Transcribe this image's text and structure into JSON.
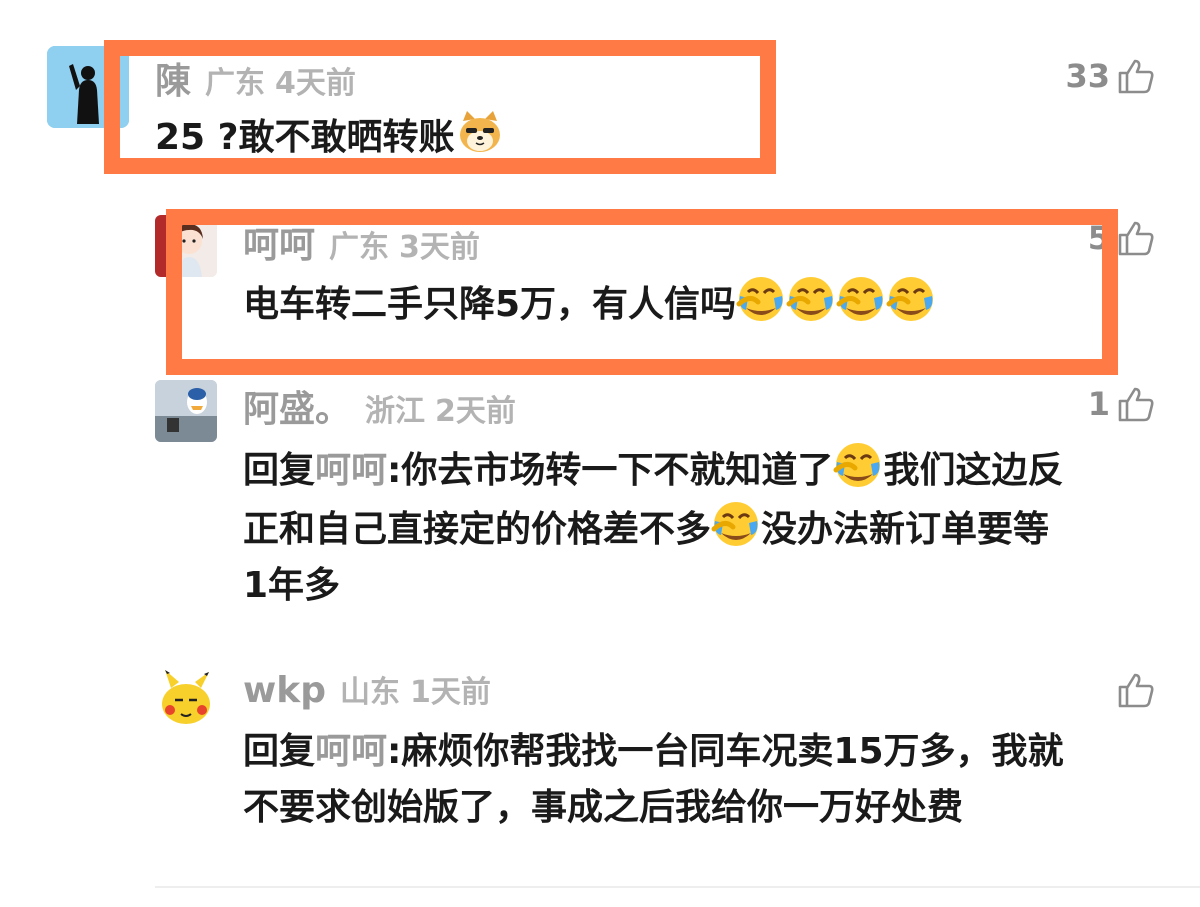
{
  "comments": [
    {
      "name": "陳",
      "location": "广东",
      "time": "4天前",
      "likes": "33",
      "lines": [
        "25 ?敢不敢晒转账"
      ]
    },
    {
      "name": "呵呵",
      "location": "广东",
      "time": "3天前",
      "likes": "5",
      "lines": [
        "电车转二手只降5万，有人信吗"
      ]
    },
    {
      "name": "阿盛。",
      "location": "浙江",
      "time": "2天前",
      "likes": "1",
      "reply_prefix": "回复",
      "reply_to": "呵呵",
      "lines": [
        ":你去市场转一下不就知道了",
        "我们这边反",
        "正和自己直接定的价格差不多",
        "没办法新订单要等",
        "1年多"
      ]
    },
    {
      "name": "wkp",
      "location": "山东",
      "time": "1天前",
      "likes": "",
      "reply_prefix": "回复",
      "reply_to": "呵呵",
      "lines": [
        ":麻烦你帮我找一台同车况卖15万多，我就",
        "不要求创始版了，事成之后我给你一万好处费"
      ]
    }
  ],
  "colors": {
    "highlight": "#ff7a45",
    "username": "#9a9a9a",
    "meta": "#b3b3b3",
    "text": "#1a1a1a"
  },
  "icons": {
    "like": "thumbs-up-outline-icon",
    "emoji_doge": "doge-emoji",
    "emoji_laugh_cry": "laugh-cry-emoji"
  }
}
